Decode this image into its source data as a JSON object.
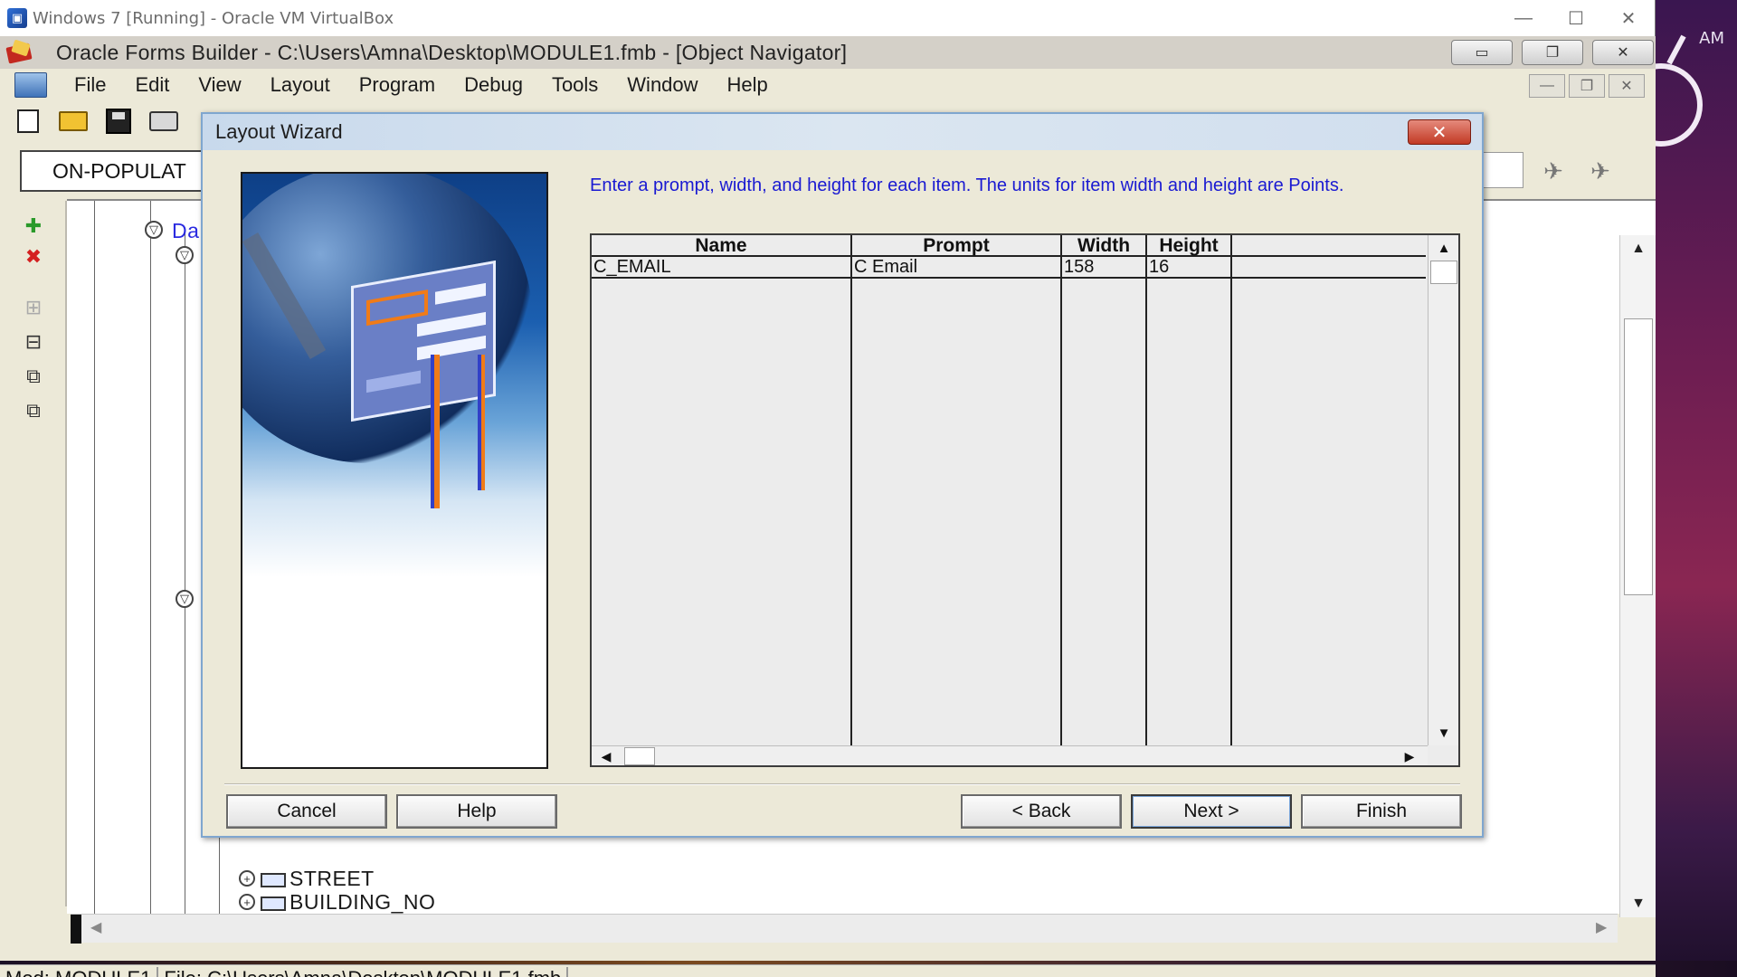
{
  "host": {
    "window_title": "Windows 7 [Running] - Oracle VM VirtualBox",
    "controls": [
      "—",
      "☐",
      "✕"
    ],
    "clock_am": "AM"
  },
  "forms_builder": {
    "title": "Oracle Forms Builder - C:\\Users\\Amna\\Desktop\\MODULE1.fmb - [Object Navigator]",
    "menu": [
      "File",
      "Edit",
      "View",
      "Layout",
      "Program",
      "Debug",
      "Tools",
      "Window",
      "Help"
    ],
    "find_field_value": "ON-POPULAT",
    "tree": {
      "truncated_label": "Da",
      "items": [
        "STREET",
        "BUILDING_NO"
      ]
    },
    "status": {
      "module": "Mod: MODULE1",
      "file": "File: C:\\Users\\Amna\\Desktop\\MODULE1.fmb"
    }
  },
  "wizard": {
    "title": "Layout Wizard",
    "close_glyph": "✕",
    "instructions": "Enter a prompt, width, and height for each item. The units for item width and height are Points.",
    "grid": {
      "columns": [
        "Name",
        "Prompt",
        "Width",
        "Height"
      ],
      "rows": [
        {
          "name": "C_EMAIL",
          "prompt": "C Email",
          "width": "158",
          "height": "16"
        }
      ]
    },
    "buttons": {
      "cancel": "Cancel",
      "help": "Help",
      "back": "< Back",
      "next": "Next >",
      "finish": "Finish"
    }
  },
  "colors": {
    "instruction_text": "#1a1ad2",
    "tree_blue": "#2a2ae0",
    "close_red": "#c23a25",
    "title_bar": "#d0deee"
  }
}
